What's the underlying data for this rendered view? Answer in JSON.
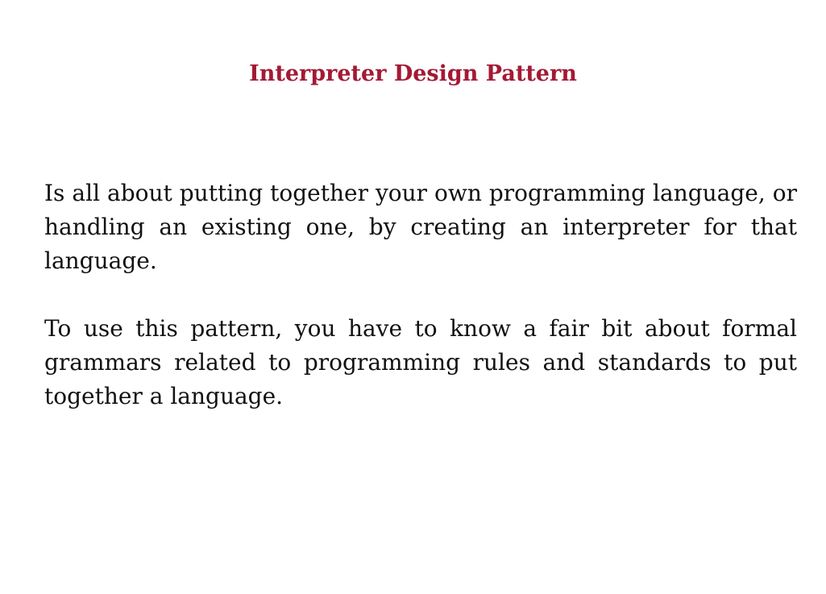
{
  "slide": {
    "title": "Interpreter Design Pattern",
    "title_color": "#a31a35",
    "paragraphs": [
      "Is all about putting together your own programming language, or handling an existing one, by creating an interpreter for that language.",
      "To use this pattern, you have to know a fair bit about formal grammars related to programming rules and standards to put together a language."
    ]
  }
}
